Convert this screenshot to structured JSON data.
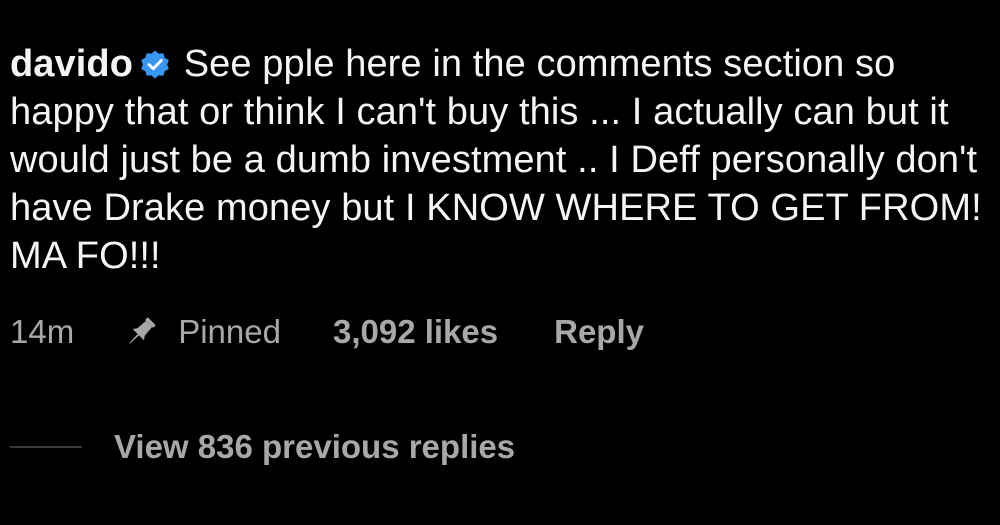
{
  "comment": {
    "username": "davido",
    "verified_icon": "verified-badge-icon",
    "text": "See pple here in the comments section so happy that or think I can't buy this ... I actually can but it would just be a dumb investment .. I Deff personally don't have Drake money but I KNOW WHERE TO GET FROM! MA FO!!!"
  },
  "meta": {
    "time": "14m",
    "pin_icon": "pushpin-icon",
    "pinned_label": "Pinned",
    "likes": "3,092 likes",
    "reply_label": "Reply"
  },
  "replies": {
    "view_label": "View 836 previous replies"
  },
  "colors": {
    "background": "#000000",
    "text": "#f5f5f5",
    "muted": "#a8a8a8",
    "verified": "#3897f0"
  }
}
